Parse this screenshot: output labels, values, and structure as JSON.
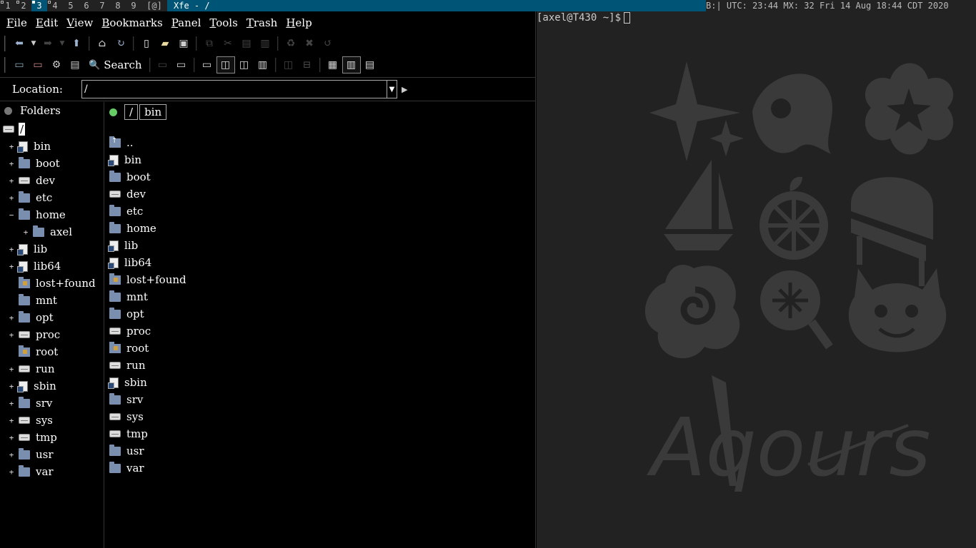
{
  "topbar": {
    "tags": [
      "1",
      "2",
      "3",
      "4",
      "5",
      "6",
      "7",
      "8",
      "9",
      "[@]"
    ],
    "selected_tag": "3",
    "window_title": "Xfe - /",
    "status": "B:| UTC: 23:44 MX: 32 Fri 14 Aug 18:44 CDT 2020"
  },
  "menubar": {
    "items": [
      {
        "label": "File",
        "key": "F",
        "rest": "ile"
      },
      {
        "label": "Edit",
        "key": "E",
        "rest": "dit"
      },
      {
        "label": "View",
        "key": "V",
        "rest": "iew"
      },
      {
        "label": "Bookmarks",
        "key": "B",
        "rest": "ookmarks"
      },
      {
        "label": "Panel",
        "key": "P",
        "rest": "anel"
      },
      {
        "label": "Tools",
        "key": "T",
        "rest": "ools"
      },
      {
        "label": "Trash",
        "key": "T",
        "rest": "rash"
      },
      {
        "label": "Help",
        "key": "H",
        "rest": "elp"
      }
    ]
  },
  "toolbar": {
    "search_label": "Search"
  },
  "location": {
    "label": "Location:",
    "value": "/"
  },
  "tree": {
    "header": "Folders",
    "root": "/",
    "items": [
      {
        "name": "bin",
        "icon": "link-icon",
        "expander": "+",
        "indent": 0
      },
      {
        "name": "boot",
        "icon": "folder-icon",
        "expander": "+",
        "indent": 0
      },
      {
        "name": "dev",
        "icon": "drive-icon",
        "expander": "+",
        "indent": 0
      },
      {
        "name": "etc",
        "icon": "folder-icon",
        "expander": "+",
        "indent": 0
      },
      {
        "name": "home",
        "icon": "folder-icon",
        "expander": "−",
        "indent": 0
      },
      {
        "name": "axel",
        "icon": "folder-icon",
        "expander": "+",
        "indent": 1
      },
      {
        "name": "lib",
        "icon": "link-icon",
        "expander": "+",
        "indent": 0
      },
      {
        "name": "lib64",
        "icon": "link-icon",
        "expander": "+",
        "indent": 0
      },
      {
        "name": "lost+found",
        "icon": "lock-folder-icon",
        "expander": "",
        "indent": 0
      },
      {
        "name": "mnt",
        "icon": "folder-icon",
        "expander": "",
        "indent": 0
      },
      {
        "name": "opt",
        "icon": "folder-icon",
        "expander": "+",
        "indent": 0
      },
      {
        "name": "proc",
        "icon": "drive-icon",
        "expander": "+",
        "indent": 0
      },
      {
        "name": "root",
        "icon": "lock-folder-icon",
        "expander": "",
        "indent": 0
      },
      {
        "name": "run",
        "icon": "drive-icon",
        "expander": "+",
        "indent": 0
      },
      {
        "name": "sbin",
        "icon": "link-icon",
        "expander": "+",
        "indent": 0
      },
      {
        "name": "srv",
        "icon": "folder-icon",
        "expander": "+",
        "indent": 0
      },
      {
        "name": "sys",
        "icon": "drive-icon",
        "expander": "+",
        "indent": 0
      },
      {
        "name": "tmp",
        "icon": "drive-icon",
        "expander": "+",
        "indent": 0
      },
      {
        "name": "usr",
        "icon": "folder-icon",
        "expander": "+",
        "indent": 0
      },
      {
        "name": "var",
        "icon": "folder-icon",
        "expander": "+",
        "indent": 0
      }
    ]
  },
  "pathbar": {
    "crumbs": [
      "/",
      "bin"
    ]
  },
  "files": [
    {
      "name": "..",
      "icon": "up-folder-icon"
    },
    {
      "name": "bin",
      "icon": "link-icon"
    },
    {
      "name": "boot",
      "icon": "folder-icon"
    },
    {
      "name": "dev",
      "icon": "drive-icon"
    },
    {
      "name": "etc",
      "icon": "folder-icon"
    },
    {
      "name": "home",
      "icon": "folder-icon"
    },
    {
      "name": "lib",
      "icon": "link-icon"
    },
    {
      "name": "lib64",
      "icon": "link-icon"
    },
    {
      "name": "lost+found",
      "icon": "lock-folder-icon"
    },
    {
      "name": "mnt",
      "icon": "folder-icon"
    },
    {
      "name": "opt",
      "icon": "folder-icon"
    },
    {
      "name": "proc",
      "icon": "drive-icon"
    },
    {
      "name": "root",
      "icon": "lock-folder-icon"
    },
    {
      "name": "run",
      "icon": "drive-icon"
    },
    {
      "name": "sbin",
      "icon": "link-icon"
    },
    {
      "name": "srv",
      "icon": "folder-icon"
    },
    {
      "name": "sys",
      "icon": "drive-icon"
    },
    {
      "name": "tmp",
      "icon": "drive-icon"
    },
    {
      "name": "usr",
      "icon": "folder-icon"
    },
    {
      "name": "var",
      "icon": "folder-icon"
    }
  ],
  "terminal": {
    "prompt": "[axel@T430 ~]$"
  },
  "wallpaper": {
    "logo_text": "Aqours"
  },
  "colors": {
    "bar_accent": "#005577",
    "bar_bg": "#222222",
    "folder": "#7a8fb0",
    "wallpaper_shapes": "#3a3a3a"
  }
}
